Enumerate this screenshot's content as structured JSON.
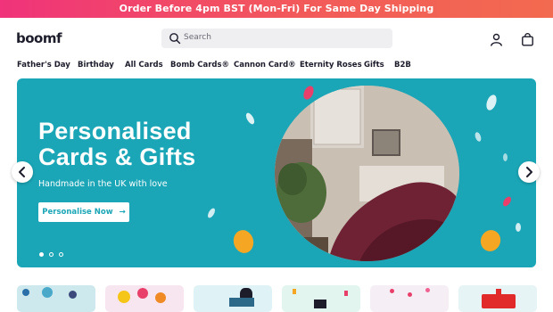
{
  "promo": {
    "text": "Order Before 4pm BST (Mon-Fri) For Same Day Shipping"
  },
  "header": {
    "logo": "boomf",
    "search": {
      "placeholder": "Search"
    },
    "icons": [
      "user-icon",
      "bag-icon"
    ]
  },
  "nav": {
    "items": [
      {
        "label": "Father's Day"
      },
      {
        "label": "Birthday"
      },
      {
        "label": "All Cards"
      },
      {
        "label": "Bomb Cards®"
      },
      {
        "label": "Cannon Card®"
      },
      {
        "label": "Eternity Roses"
      },
      {
        "label": "Gifts"
      },
      {
        "label": "B2B"
      }
    ]
  },
  "hero": {
    "title_line1": "Personalised",
    "title_line2": "Cards & Gifts",
    "subtitle": "Handmade in the UK with love",
    "button": "Personalise Now",
    "button_icon": "arrow-right-icon",
    "slides": 3,
    "active_slide": 1,
    "background": "#1aa6b7"
  },
  "colors": {
    "promo_start": "#f0337a",
    "promo_end": "#f26a4f",
    "text_dark": "#1c1c2b",
    "hero_teal": "#1aa6b7"
  }
}
